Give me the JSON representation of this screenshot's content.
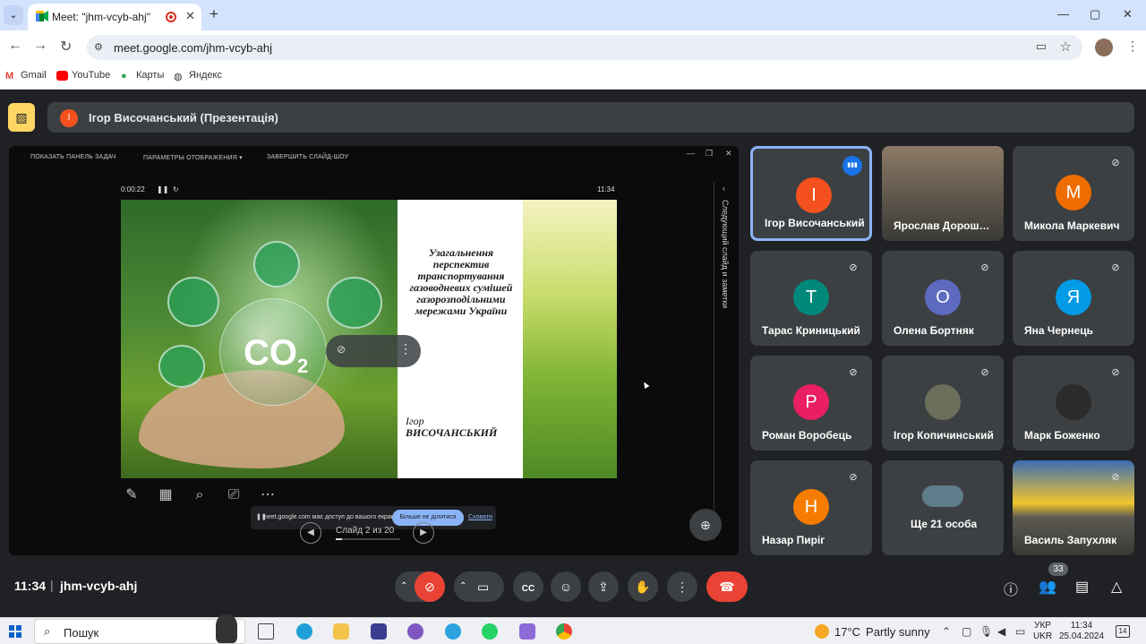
{
  "browser": {
    "tab_title": "Meet: \"jhm-vcyb-ahj\"",
    "url": "meet.google.com/jhm-vcyb-ahj",
    "bookmarks": [
      "Gmail",
      "YouTube",
      "Карты",
      "Яндекс"
    ]
  },
  "presentation": {
    "banner_initial": "I",
    "banner_text": "Ігор Височанський (Презентація)",
    "top_buttons": [
      "ПОКАЗАТЬ ПАНЕЛЬ ЗАДАЧ",
      "ПАРАМЕТРЫ ОТОБРАЖЕНИЯ ▾",
      "ЗАВЕРШИТЬ СЛАЙД-ШОУ"
    ],
    "timer": "0:00:22",
    "clock": "11:34",
    "side_label": "Следующий слайд и заметки",
    "slide_title": "Узагальнення перспектив транспортування газоводневих сумішей газорозподільними мережами України",
    "author_first": "Ігор",
    "author_last": "ВИСОЧАНСЬКИЙ",
    "co2_text": "CO",
    "co2_sub": "2",
    "slide_counter": "Слайд 2 из 20",
    "slide_progress": 0.1,
    "share_msg": "meet.google.com має доступ до вашого екрана.",
    "share_stop": "Більше не ділитися",
    "share_hide": "Сховати"
  },
  "participants": [
    {
      "name": "Ігор Височанський",
      "initial": "I",
      "color": "#f4511e",
      "active": true
    },
    {
      "name": "Ярослав Дорошенко",
      "initial": "",
      "color": "#8c7a66",
      "active": false,
      "photo": true
    },
    {
      "name": "Микола Маркевич",
      "initial": "M",
      "color": "#ef6c00",
      "active": false
    },
    {
      "name": "Тарас Криницький",
      "initial": "T",
      "color": "#00897b",
      "active": false
    },
    {
      "name": "Олена Бортняк",
      "initial": "O",
      "color": "#5c6bc0",
      "active": false
    },
    {
      "name": "Яна Чернець",
      "initial": "Я",
      "color": "#039be5",
      "active": false
    },
    {
      "name": "Роман Воробець",
      "initial": "P",
      "color": "#e91e63",
      "active": false
    },
    {
      "name": "Ігор Копичинський",
      "initial": "",
      "color": "#6b6f5a",
      "active": false,
      "photo": true
    },
    {
      "name": "Марк Боженко",
      "initial": "",
      "color": "#2b2b2b",
      "active": false,
      "photo": true
    },
    {
      "name": "Назар Пиріг",
      "initial": "H",
      "color": "#f57c00",
      "active": false
    },
    {
      "name": "Ще 21 особа",
      "initial": "",
      "color": "#607d8b",
      "active": false
    },
    {
      "name": "Василь Запухляк",
      "initial": "",
      "color": "#7d7a6e",
      "active": false,
      "photo": true
    }
  ],
  "meeting": {
    "time": "11:34",
    "code": "jhm-vcyb-ahj",
    "people_count": "33"
  },
  "taskbar": {
    "search_placeholder": "Пошук",
    "weather_temp": "17°C",
    "weather_desc": "Partly sunny",
    "lang_top": "УКР",
    "lang_bottom": "UKR",
    "time": "11:34",
    "date": "25.04.2024",
    "notifications": "14"
  },
  "colors": {
    "meet_bg": "#202124",
    "tile_bg": "#3c4043",
    "active_border": "#8ab4f8",
    "end_call": "#ea4335",
    "present_icon": "#fdd663"
  }
}
